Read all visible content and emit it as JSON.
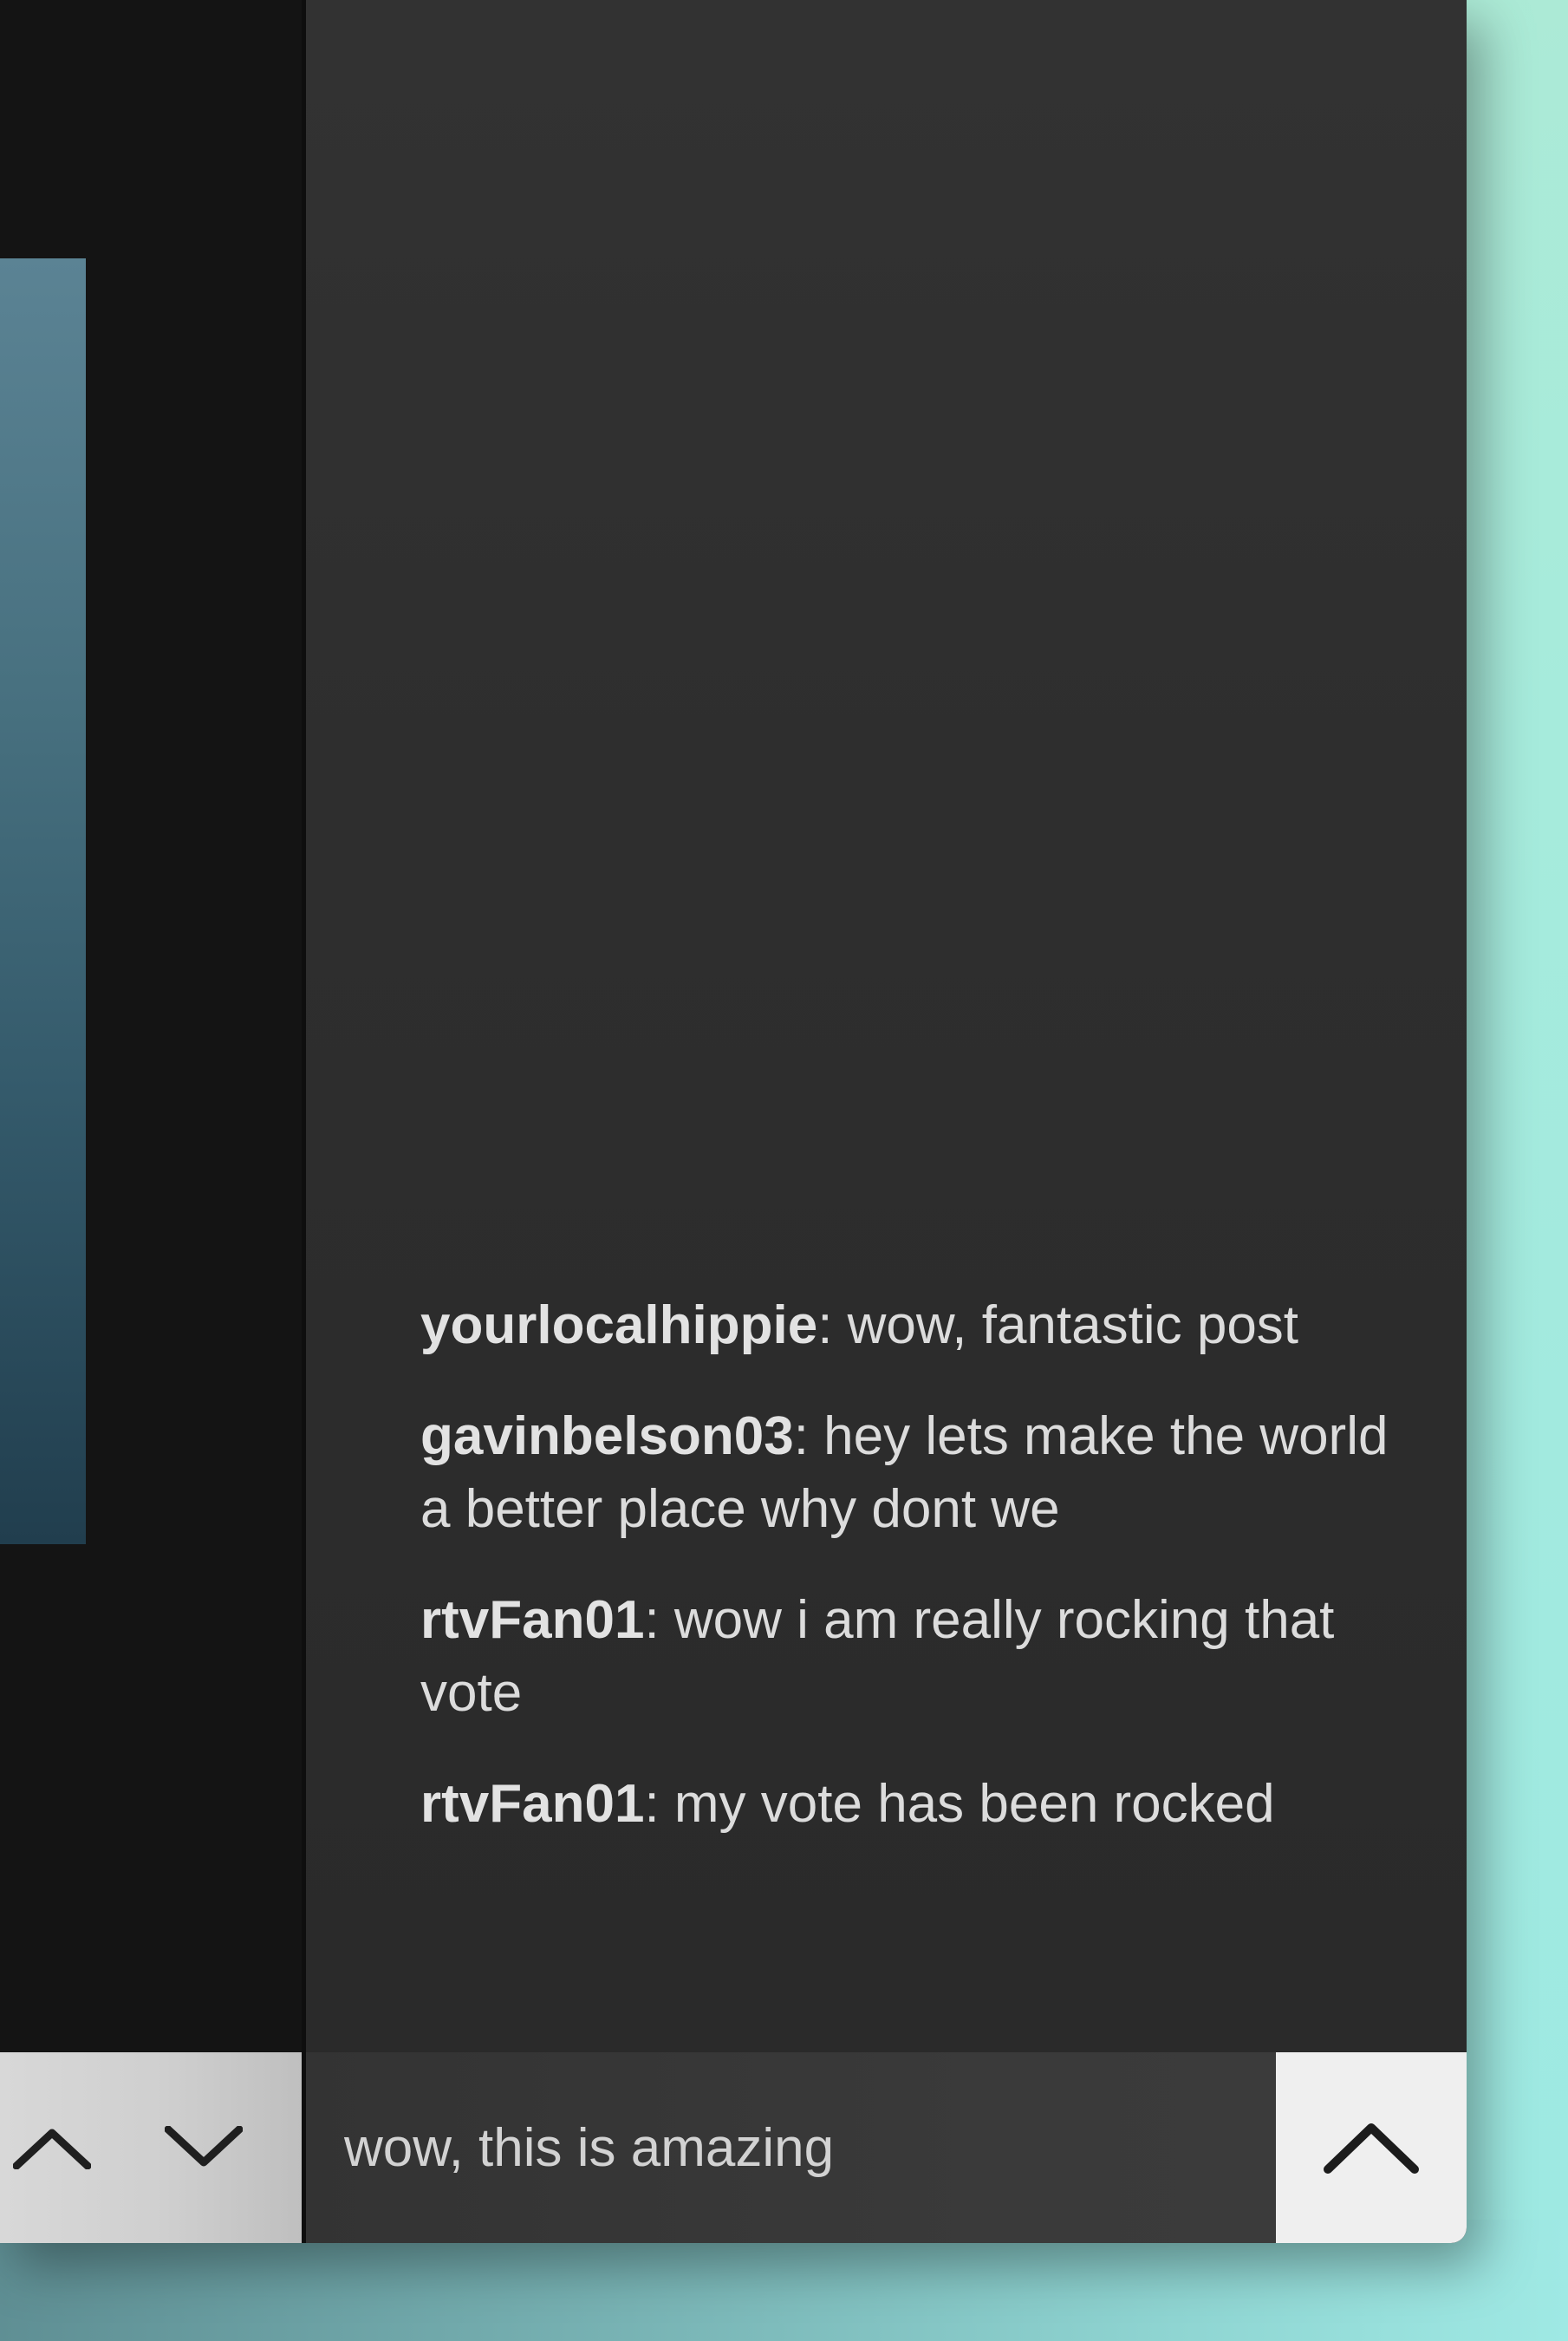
{
  "chat": {
    "messages": [
      {
        "user": "yourlocalhippie",
        "separator": ": ",
        "text": "wow, fantastic post"
      },
      {
        "user": "gavinbelson03",
        "separator": ": ",
        "text": "hey lets make the world a better place why dont we"
      },
      {
        "user": "rtvFan01",
        "separator": ": ",
        "text": "wow i am really rocking that vote"
      },
      {
        "user": "rtvFan01",
        "separator": ": ",
        "text": "my vote has been rocked"
      }
    ]
  },
  "composer": {
    "value": "wow, this is amazing",
    "send_icon": "chevron-up-icon"
  },
  "vote_controls": {
    "upvote_icon": "chevron-up-icon",
    "downvote_icon": "chevron-down-icon"
  },
  "colors": {
    "chat_background": "#2e2e2e",
    "composer_background": "#383838",
    "send_button_background": "#efefef",
    "username_text": "#e2e2e2",
    "message_text": "#dcdcdc",
    "vote_bar_background": "#cfcfcf"
  }
}
